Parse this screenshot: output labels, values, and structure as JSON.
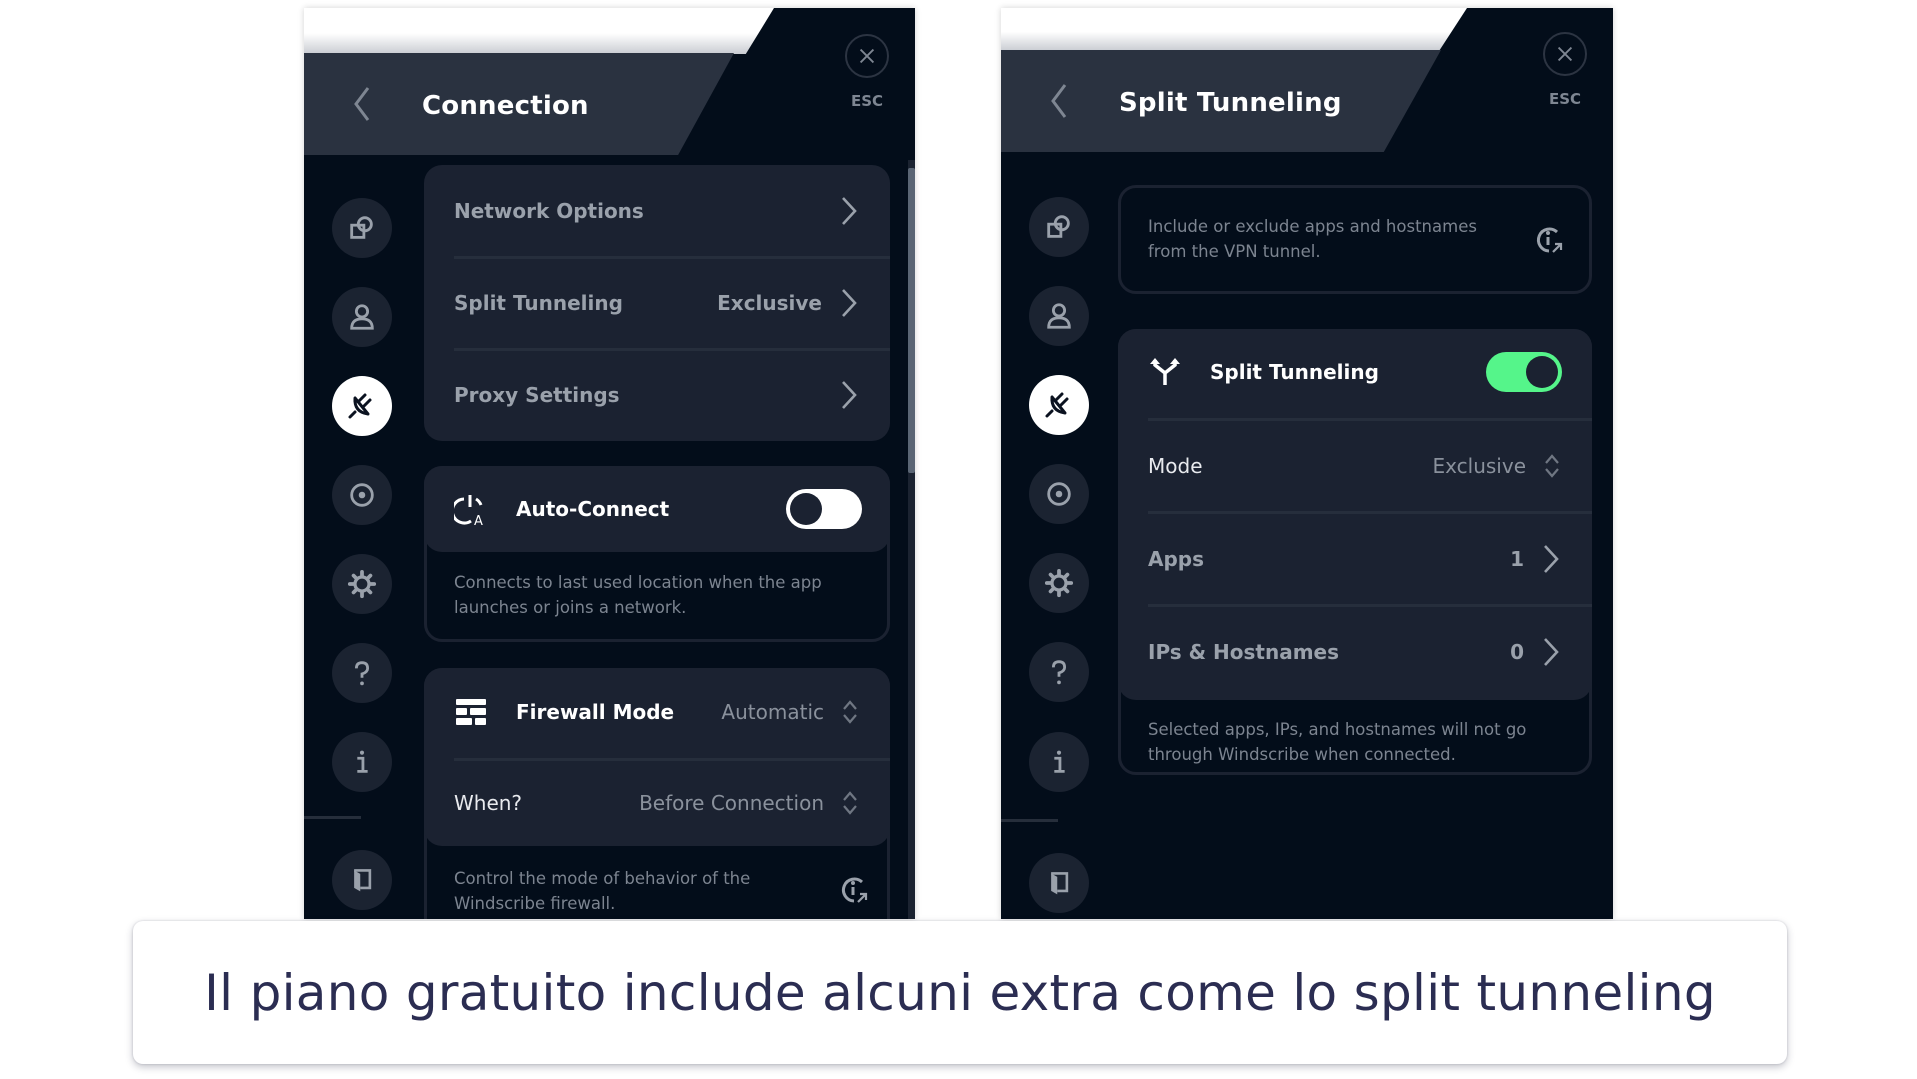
{
  "colors": {
    "panel_bg": "#030d1a",
    "card_bg": "#1b2231",
    "header_tab": "#2a3240",
    "accent_green": "#55f58a",
    "caption_text": "#2b2d52"
  },
  "left_panel": {
    "title": "Connection",
    "esc_label": "ESC",
    "sidebar": [
      {
        "icon": "location-icon",
        "active": false
      },
      {
        "icon": "account-icon",
        "active": false
      },
      {
        "icon": "connection-plug-icon",
        "active": true
      },
      {
        "icon": "robert-icon",
        "active": false
      },
      {
        "icon": "gear-icon",
        "active": false
      },
      {
        "icon": "help-icon",
        "active": false
      },
      {
        "icon": "info-icon",
        "active": false
      },
      {
        "icon": "exit-door-icon",
        "active": false
      }
    ],
    "menu": {
      "items": [
        {
          "label": "Network Options",
          "value": ""
        },
        {
          "label": "Split Tunneling",
          "value": "Exclusive"
        },
        {
          "label": "Proxy Settings",
          "value": ""
        }
      ]
    },
    "auto_connect": {
      "label": "Auto-Connect",
      "enabled": false,
      "description_line1": "Connects to last used location when the app",
      "description_line2": "launches or joins a network."
    },
    "firewall": {
      "label": "Firewall Mode",
      "value": "Automatic",
      "when_label": "When?",
      "when_value": "Before Connection",
      "description_line1": "Control the mode of behavior of the",
      "description_line2": "Windscribe firewall."
    }
  },
  "right_panel": {
    "title": "Split Tunneling",
    "esc_label": "ESC",
    "info": {
      "line1": "Include or exclude apps and hostnames",
      "line2": "from the VPN tunnel."
    },
    "split_tunneling": {
      "label": "Split Tunneling",
      "enabled": true,
      "mode_label": "Mode",
      "mode_value": "Exclusive",
      "apps_label": "Apps",
      "apps_count": "1",
      "ips_label": "IPs & Hostnames",
      "ips_count": "0",
      "description_line1": "Selected apps, IPs, and hostnames will not go",
      "description_line2": "through Windscribe when connected."
    }
  },
  "caption": {
    "text": "Il piano gratuito include alcuni extra come lo split tunneling"
  }
}
